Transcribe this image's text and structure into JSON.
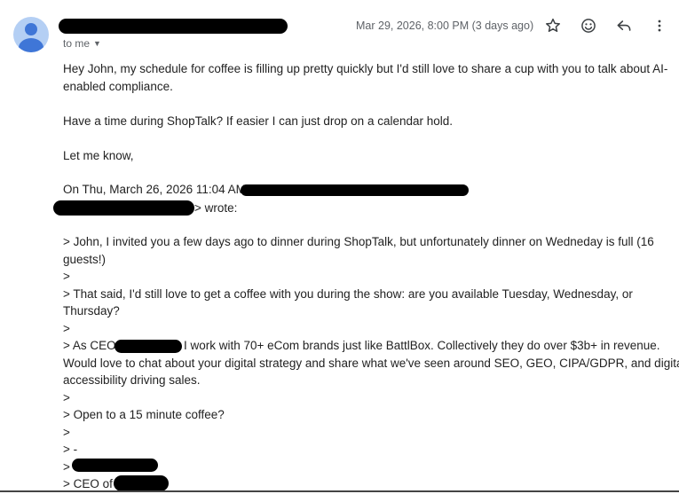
{
  "header": {
    "recipient_label": "to me",
    "recipient_dropdown_icon": "caret-down-icon",
    "timestamp": "Mar 29, 2026, 8:00 PM (3 days ago)",
    "icons": [
      "star-icon",
      "emoji-icon",
      "reply-icon",
      "more-vert-icon"
    ]
  },
  "message": {
    "line_1": "Hey John, my schedule for coffee is filling up pretty quickly but I'd still love to share a cup with you to talk about AI-",
    "line_2": "enabled compliance.",
    "line_3": "Have a time during ShopTalk? If easier I can just drop on a calendar hold.",
    "line_4": "Let me know,"
  },
  "quoted": {
    "attribution": "On Thu, March 26, 2026 11:04 AM,",
    "wrote": "> wrote:",
    "q1": "> John, I invited you a few days ago to dinner during ShopTalk, but unfortunately dinner on Wedneday is full (16",
    "q2": "guests!)",
    "q3": ">",
    "q4": "> That said, I'd still love to get a coffee with you during the show: are you available Tuesday, Wednesday, or",
    "q5": "Thursday?",
    "q6": ">",
    "q7a": "> As CEO",
    "q7b": "I work with 70+ eCom brands just like BattlBox. Collectively they do over $3b+ in revenue.",
    "q8": "Would love to chat about your digital strategy and share what we've seen around SEO, GEO, CIPA/GDPR, and digital",
    "q9": "accessibility driving sales.",
    "q10": ">",
    "q11": "> Open to a 15 minute coffee?",
    "q12": ">",
    "q13": "> -",
    "q14": ">",
    "q15": "> CEO of"
  }
}
